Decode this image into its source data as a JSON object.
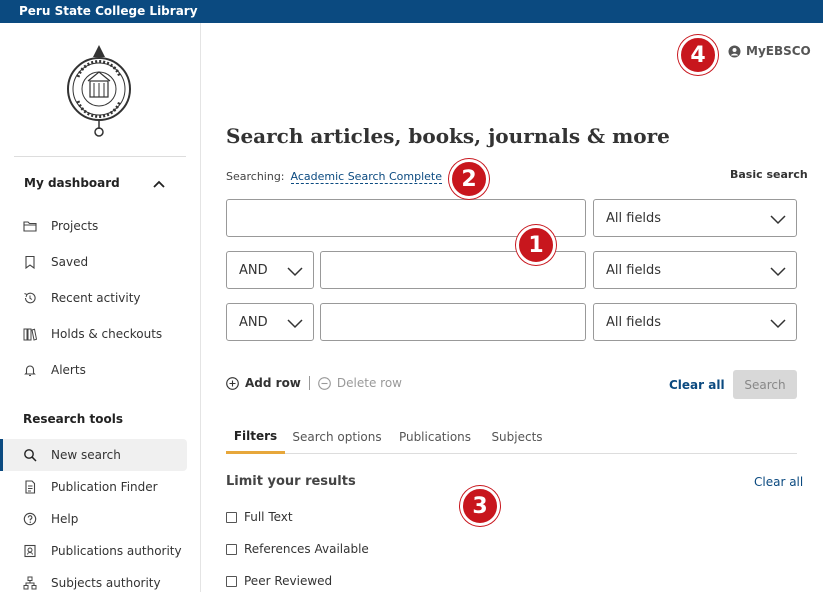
{
  "topbar": {
    "title": "Peru State College Library"
  },
  "sidebar": {
    "dashboard_heading": "My dashboard",
    "dashboard_items": [
      {
        "label": "Projects",
        "icon": "folder-icon"
      },
      {
        "label": "Saved",
        "icon": "bookmark-icon"
      },
      {
        "label": "Recent activity",
        "icon": "history-icon"
      },
      {
        "label": "Holds & checkouts",
        "icon": "books-icon"
      },
      {
        "label": "Alerts",
        "icon": "bell-icon"
      }
    ],
    "research_heading": "Research tools",
    "research_items": [
      {
        "label": "New search",
        "icon": "search-icon",
        "active": true
      },
      {
        "label": "Publication Finder",
        "icon": "document-icon"
      },
      {
        "label": "Help",
        "icon": "help-icon"
      },
      {
        "label": "Publications authority",
        "icon": "authority-icon"
      },
      {
        "label": "Subjects authority",
        "icon": "hierarchy-icon"
      }
    ]
  },
  "header": {
    "myebsco_label": "MyEBSCO"
  },
  "main": {
    "title": "Search articles, books, journals & more",
    "searching_label": "Searching:",
    "database": "Academic Search Complete",
    "basic_search": "Basic search",
    "rows": [
      {
        "operator": "",
        "value": "",
        "field": "All fields"
      },
      {
        "operator": "AND",
        "value": "",
        "field": "All fields"
      },
      {
        "operator": "AND",
        "value": "",
        "field": "All fields"
      }
    ],
    "add_row": "Add row",
    "delete_row": "Delete row",
    "clear_all": "Clear all",
    "search_button": "Search",
    "tabs": [
      "Filters",
      "Search options",
      "Publications",
      "Subjects"
    ],
    "limit_heading": "Limit your results",
    "limit_clear_all": "Clear all",
    "limits": [
      {
        "label": "Full Text",
        "checked": false
      },
      {
        "label": "References Available",
        "checked": false
      },
      {
        "label": "Peer Reviewed",
        "checked": false
      }
    ]
  },
  "annotations": [
    "1",
    "2",
    "3",
    "4"
  ],
  "colors": {
    "brand": "#0b4a80",
    "badge": "#c8161d",
    "tab_accent": "#e7a73b"
  }
}
